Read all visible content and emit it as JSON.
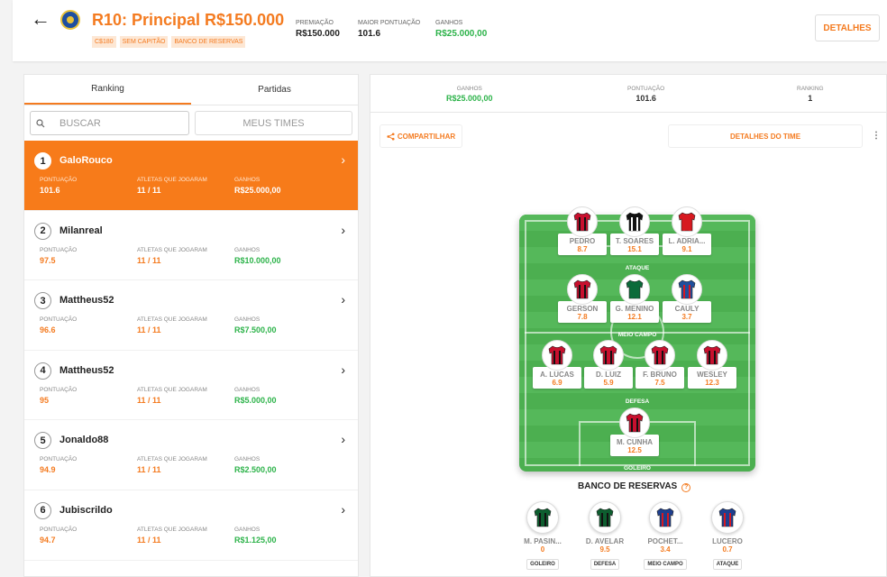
{
  "header": {
    "title": "R10: Principal R$150.000",
    "tags": [
      "C$180",
      "SEM CAPITÃO",
      "BANCO DE RESERVAS"
    ],
    "stats": [
      {
        "label": "PREMIAÇÃO",
        "value": "R$150.000"
      },
      {
        "label": "MAIOR PONTUAÇÃO",
        "value": "101.6"
      },
      {
        "label": "GANHOS",
        "value": "R$25.000,00"
      }
    ],
    "details_label": "DETALHES"
  },
  "left": {
    "tabs": [
      "Ranking",
      "Partidas"
    ],
    "search_placeholder": "BUSCAR",
    "my_teams_label": "MEUS TIMES",
    "col_labels": [
      "PONTUAÇÃO",
      "ATLETAS QUE JOGARAM",
      "GANHOS"
    ],
    "rankings": [
      {
        "pos": "1",
        "name": "GaloRouco",
        "score": "101.6",
        "played": "11 / 11",
        "won": "R$25.000,00"
      },
      {
        "pos": "2",
        "name": "Milanreal",
        "score": "97.5",
        "played": "11 / 11",
        "won": "R$10.000,00"
      },
      {
        "pos": "3",
        "name": "Mattheus52",
        "score": "96.6",
        "played": "11 / 11",
        "won": "R$7.500,00"
      },
      {
        "pos": "4",
        "name": "Mattheus52",
        "score": "95",
        "played": "11 / 11",
        "won": "R$5.000,00"
      },
      {
        "pos": "5",
        "name": "Jonaldo88",
        "score": "94.9",
        "played": "11 / 11",
        "won": "R$2.500,00"
      },
      {
        "pos": "6",
        "name": "Jubiscrildo",
        "score": "94.7",
        "played": "11 / 11",
        "won": "R$1.125,00"
      }
    ]
  },
  "right": {
    "stats": [
      {
        "label": "GANHOS",
        "value": "R$25.000,00"
      },
      {
        "label": "PONTUAÇÃO",
        "value": "101.6"
      },
      {
        "label": "RANKING",
        "value": "1"
      }
    ],
    "share_label": "COMPARTILHAR",
    "team_details_label": "DETALHES DO TIME",
    "zones": {
      "attack": "ATAQUE",
      "mid": "MEIO CAMPO",
      "def": "DEFESA",
      "gk": "GOLEIRO"
    },
    "players": {
      "attack": [
        {
          "name": "PEDRO",
          "score": "8.7",
          "kit": "fla"
        },
        {
          "name": "T. SOARES",
          "score": "15.1",
          "kit": "bot"
        },
        {
          "name": "L. ADRIA...",
          "score": "9.1",
          "kit": "inter"
        }
      ],
      "mid": [
        {
          "name": "GERSON",
          "score": "7.8",
          "kit": "fla"
        },
        {
          "name": "G. MENINO",
          "score": "12.1",
          "kit": "pal"
        },
        {
          "name": "CAULY",
          "score": "3.7",
          "kit": "bah"
        }
      ],
      "def": [
        {
          "name": "A. LUCAS",
          "score": "6.9",
          "kit": "fla"
        },
        {
          "name": "D. LUIZ",
          "score": "5.9",
          "kit": "fla"
        },
        {
          "name": "F. BRUNO",
          "score": "7.5",
          "kit": "fla"
        },
        {
          "name": "WESLEY",
          "score": "12.3",
          "kit": "fla"
        }
      ],
      "gk": [
        {
          "name": "M. CUNHA",
          "score": "12.5",
          "kit": "fla"
        }
      ]
    },
    "bench_title": "BANCO DE RESERVAS",
    "bench": [
      {
        "name": "M. PASIN...",
        "score": "0",
        "pos": "GOLEIRO",
        "kit": "cor"
      },
      {
        "name": "D. AVELAR",
        "score": "9.5",
        "pos": "DEFESA",
        "kit": "cor"
      },
      {
        "name": "POCHET...",
        "score": "3.4",
        "pos": "MEIO CAMPO",
        "kit": "for"
      },
      {
        "name": "LUCERO",
        "score": "0.7",
        "pos": "ATAQUE",
        "kit": "for"
      }
    ],
    "kit_colors": {
      "fla": [
        "#c8102e",
        "#111111"
      ],
      "bot": [
        "#111111",
        "#ffffff"
      ],
      "inter": [
        "#d71920",
        "#d71920"
      ],
      "pal": [
        "#0b6b3a",
        "#0b6b3a"
      ],
      "bah": [
        "#1f4f9c",
        "#d71920"
      ],
      "cor": [
        "#0d5e2f",
        "#111111"
      ],
      "for": [
        "#1e3f8f",
        "#d71920"
      ]
    }
  }
}
